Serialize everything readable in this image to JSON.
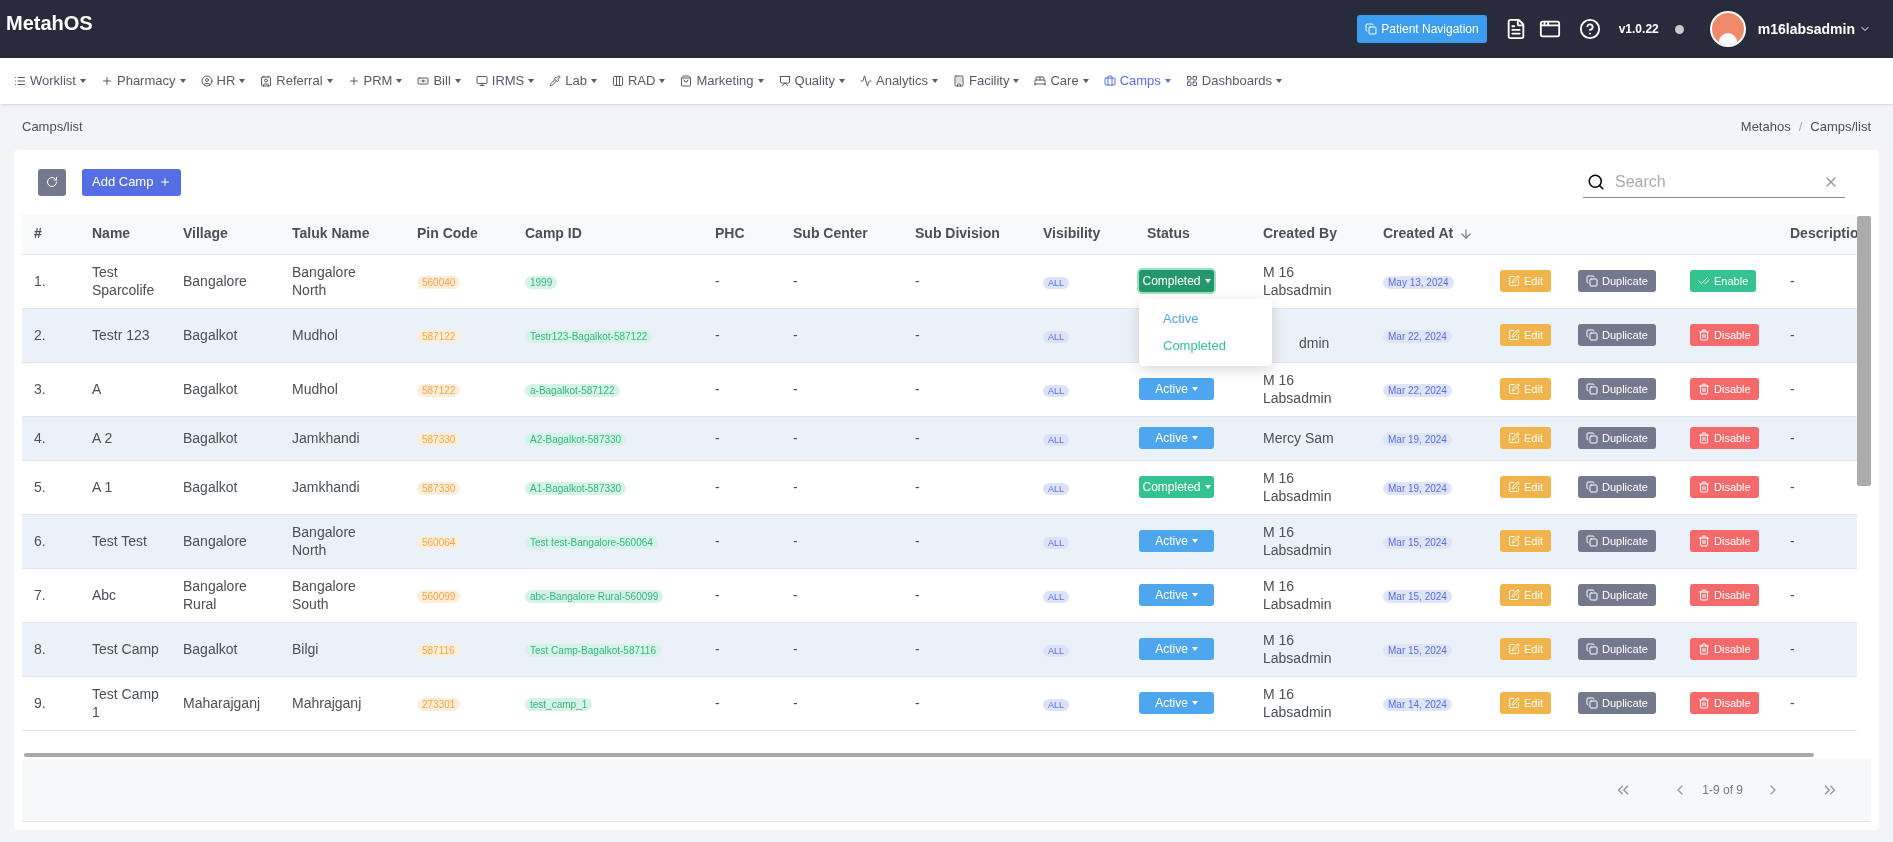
{
  "app": {
    "logo": "MetahOS"
  },
  "header": {
    "patient_nav": "Patient Navigation",
    "version": "v1.0.22",
    "user": "m16labsadmin"
  },
  "nav": [
    {
      "label": "Worklist",
      "selected": false
    },
    {
      "label": "Pharmacy",
      "selected": false
    },
    {
      "label": "HR",
      "selected": false
    },
    {
      "label": "Referral",
      "selected": false
    },
    {
      "label": "PRM",
      "selected": false
    },
    {
      "label": "Bill",
      "selected": false
    },
    {
      "label": "IRMS",
      "selected": false
    },
    {
      "label": "Lab",
      "selected": false
    },
    {
      "label": "RAD",
      "selected": false
    },
    {
      "label": "Marketing",
      "selected": false
    },
    {
      "label": "Quality",
      "selected": false
    },
    {
      "label": "Analytics",
      "selected": false
    },
    {
      "label": "Facility",
      "selected": false
    },
    {
      "label": "Care",
      "selected": false
    },
    {
      "label": "Camps",
      "selected": true
    },
    {
      "label": "Dashboards",
      "selected": false
    }
  ],
  "breadcrumb": {
    "title": "Camps/list",
    "trail": [
      "Metahos",
      "Camps/list"
    ],
    "separator": "/"
  },
  "toolbar": {
    "add_label": "Add Camp"
  },
  "search": {
    "placeholder": "Search"
  },
  "table": {
    "columns": [
      {
        "label": "#",
        "sorted": false
      },
      {
        "label": "Name",
        "sorted": false
      },
      {
        "label": "Village",
        "sorted": false
      },
      {
        "label": "Taluk Name",
        "sorted": false
      },
      {
        "label": "Pin Code",
        "sorted": false
      },
      {
        "label": "Camp ID",
        "sorted": false
      },
      {
        "label": "PHC",
        "sorted": false
      },
      {
        "label": "Sub Center",
        "sorted": false
      },
      {
        "label": "Sub Division",
        "sorted": false
      },
      {
        "label": "Visibility",
        "sorted": false
      },
      {
        "label": "Status",
        "sorted": false
      },
      {
        "label": "Created By",
        "sorted": false
      },
      {
        "label": "Created At",
        "sorted": true
      },
      {
        "label": "Descriptio",
        "sorted": false
      }
    ],
    "rows": [
      {
        "index": "1.",
        "name": "Test Sparcolife",
        "village": "Bangalore",
        "taluk": "Bangalore North",
        "pin": "560040",
        "camp_id": "1999",
        "phc": "-",
        "sub_center": "-",
        "sub_division": "-",
        "visibility": "ALL",
        "status": {
          "label": "Completed",
          "kind": "completed",
          "open": true
        },
        "created_by": "M 16 Labsadmin",
        "created_at": "May 13, 2024",
        "actions": [
          {
            "label": "Edit",
            "kind": "edit"
          },
          {
            "label": "Duplicate",
            "kind": "duplicate"
          },
          {
            "label": "Enable",
            "kind": "enable"
          }
        ],
        "description": "-"
      },
      {
        "index": "2.",
        "name": "Testr 123",
        "village": "Bagalkot",
        "taluk": "Mudhol",
        "pin": "587122",
        "camp_id": "Testr123-Bagalkot-587122",
        "phc": "-",
        "sub_center": "-",
        "sub_division": "-",
        "visibility": "ALL",
        "created_by": "dmin",
        "created_at": "Mar 22, 2024",
        "actions": [
          {
            "label": "Edit",
            "kind": "edit"
          },
          {
            "label": "Duplicate",
            "kind": "duplicate"
          },
          {
            "label": "Disable",
            "kind": "disable"
          }
        ],
        "description": "-"
      },
      {
        "index": "3.",
        "name": "A",
        "village": "Bagalkot",
        "taluk": "Mudhol",
        "pin": "587122",
        "camp_id": "a-Bagalkot-587122",
        "phc": "-",
        "sub_center": "-",
        "sub_division": "-",
        "visibility": "ALL",
        "status": {
          "label": "Active",
          "kind": "active",
          "open": false
        },
        "created_by": "M 16 Labsadmin",
        "created_at": "Mar 22, 2024",
        "actions": [
          {
            "label": "Edit",
            "kind": "edit"
          },
          {
            "label": "Duplicate",
            "kind": "duplicate"
          },
          {
            "label": "Disable",
            "kind": "disable"
          }
        ],
        "description": "-"
      },
      {
        "index": "4.",
        "name": "A 2",
        "village": "Bagalkot",
        "taluk": "Jamkhandi",
        "pin": "587330",
        "camp_id": "A2-Bagalkot-587330",
        "phc": "-",
        "sub_center": "-",
        "sub_division": "-",
        "visibility": "ALL",
        "status": {
          "label": "Active",
          "kind": "active",
          "open": false
        },
        "created_by": "Mercy Sam",
        "created_at": "Mar 19, 2024",
        "actions": [
          {
            "label": "Edit",
            "kind": "edit"
          },
          {
            "label": "Duplicate",
            "kind": "duplicate"
          },
          {
            "label": "Disable",
            "kind": "disable"
          }
        ],
        "description": "-"
      },
      {
        "index": "5.",
        "name": "A 1",
        "village": "Bagalkot",
        "taluk": "Jamkhandi",
        "pin": "587330",
        "camp_id": "A1-Bagalkot-587330",
        "phc": "-",
        "sub_center": "-",
        "sub_division": "-",
        "visibility": "ALL",
        "status": {
          "label": "Completed",
          "kind": "completed",
          "open": false
        },
        "created_by": "M 16 Labsadmin",
        "created_at": "Mar 19, 2024",
        "actions": [
          {
            "label": "Edit",
            "kind": "edit"
          },
          {
            "label": "Duplicate",
            "kind": "duplicate"
          },
          {
            "label": "Disable",
            "kind": "disable"
          }
        ],
        "description": "-"
      },
      {
        "index": "6.",
        "name": "Test Test",
        "village": "Bangalore",
        "taluk": "Bangalore North",
        "pin": "560064",
        "camp_id": "Test test-Bangalore-560064",
        "phc": "-",
        "sub_center": "-",
        "sub_division": "-",
        "visibility": "ALL",
        "status": {
          "label": "Active",
          "kind": "active",
          "open": false
        },
        "created_by": "M 16 Labsadmin",
        "created_at": "Mar 15, 2024",
        "actions": [
          {
            "label": "Edit",
            "kind": "edit"
          },
          {
            "label": "Duplicate",
            "kind": "duplicate"
          },
          {
            "label": "Disable",
            "kind": "disable"
          }
        ],
        "description": "-"
      },
      {
        "index": "7.",
        "name": "Abc",
        "village": "Bangalore Rural",
        "taluk": "Bangalore South",
        "pin": "560099",
        "camp_id": "abc-Bangalore Rural-560099",
        "phc": "-",
        "sub_center": "-",
        "sub_division": "-",
        "visibility": "ALL",
        "status": {
          "label": "Active",
          "kind": "active",
          "open": false
        },
        "created_by": "M 16 Labsadmin",
        "created_at": "Mar 15, 2024",
        "actions": [
          {
            "label": "Edit",
            "kind": "edit"
          },
          {
            "label": "Duplicate",
            "kind": "duplicate"
          },
          {
            "label": "Disable",
            "kind": "disable"
          }
        ],
        "description": "-"
      },
      {
        "index": "8.",
        "name": "Test Camp",
        "village": "Bagalkot",
        "taluk": "Bilgi",
        "pin": "587116",
        "camp_id": "Test Camp-Bagalkot-587116",
        "phc": "-",
        "sub_center": "-",
        "sub_division": "-",
        "visibility": "ALL",
        "status": {
          "label": "Active",
          "kind": "active",
          "open": false
        },
        "created_by": "M 16 Labsadmin",
        "created_at": "Mar 15, 2024",
        "actions": [
          {
            "label": "Edit",
            "kind": "edit"
          },
          {
            "label": "Duplicate",
            "kind": "duplicate"
          },
          {
            "label": "Disable",
            "kind": "disable"
          }
        ],
        "description": "-"
      },
      {
        "index": "9.",
        "name": "Test Camp 1",
        "village": "Maharajganj",
        "taluk": "Mahrajganj",
        "pin": "273301",
        "camp_id": "test_camp_1",
        "phc": "-",
        "sub_center": "-",
        "sub_division": "-",
        "visibility": "ALL",
        "status": {
          "label": "Active",
          "kind": "active",
          "open": false
        },
        "created_by": "M 16 Labsadmin",
        "created_at": "Mar 14, 2024",
        "actions": [
          {
            "label": "Edit",
            "kind": "edit"
          },
          {
            "label": "Duplicate",
            "kind": "duplicate"
          },
          {
            "label": "Disable",
            "kind": "disable"
          }
        ],
        "description": "-"
      }
    ]
  },
  "status_menu": {
    "options": [
      {
        "label": "Active",
        "kind": "active"
      },
      {
        "label": "Completed",
        "kind": "completed"
      }
    ]
  },
  "pagination": {
    "range": "1-9 of 9"
  }
}
